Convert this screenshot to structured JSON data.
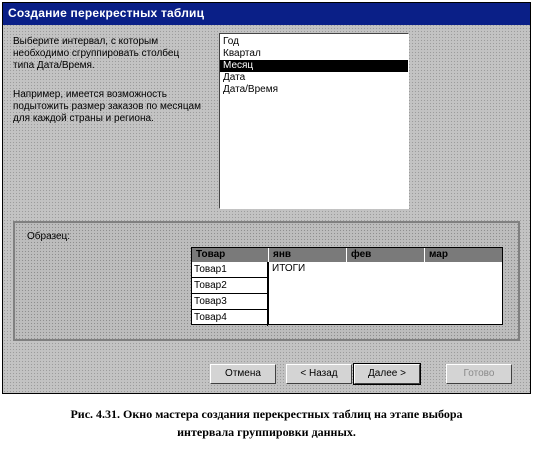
{
  "window": {
    "title": "Создание перекрестных таблиц"
  },
  "intro": {
    "para1": "Выберите интервал, с которым необходимо сгруппировать столбец типа Дата/Время.",
    "para2": "Например, имеется возможность подытожить размер заказов по месяцам для каждой страны и региона."
  },
  "intervals": {
    "items": [
      "Год",
      "Квартал",
      "Месяц",
      "Дата",
      "Дата/Время"
    ],
    "selected": "Месяц"
  },
  "sample": {
    "label": "Образец:",
    "header": [
      "Товар",
      "янв",
      "фев",
      "мар"
    ],
    "rows": [
      "Товар1",
      "Товар2",
      "Товар3",
      "Товар4"
    ],
    "totals": "ИТОГИ"
  },
  "buttons": {
    "cancel": "Отмена",
    "back": "< Назад",
    "next": "Далее >",
    "finish": "Готово"
  },
  "caption": {
    "line1": "Рис. 4.31. Окно мастера создания перекрестных таблиц на этапе выбора",
    "line2": "интервала группировки данных."
  }
}
